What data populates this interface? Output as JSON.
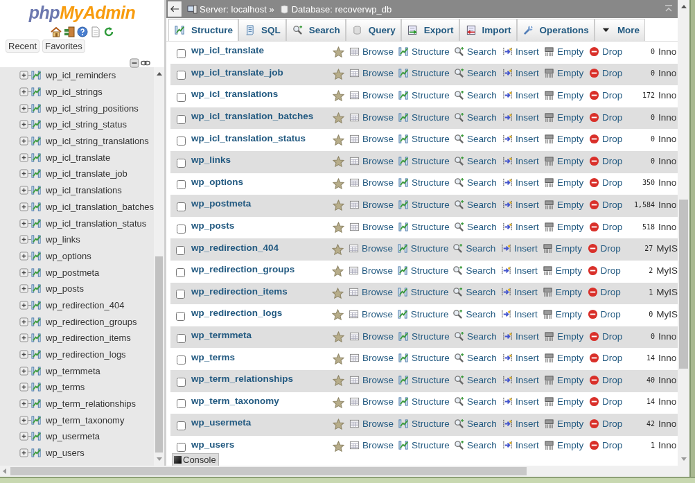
{
  "sidebar": {
    "logo": {
      "part_1": "php",
      "part_2": "MyAdmin"
    },
    "buttons": [
      "Recent",
      "Favorites"
    ],
    "tree": [
      {
        "label": "wp_icl_reminders"
      },
      {
        "label": "wp_icl_strings"
      },
      {
        "label": "wp_icl_string_positions"
      },
      {
        "label": "wp_icl_string_status"
      },
      {
        "label": "wp_icl_string_translations"
      },
      {
        "label": "wp_icl_translate"
      },
      {
        "label": "wp_icl_translate_job"
      },
      {
        "label": "wp_icl_translations"
      },
      {
        "label": "wp_icl_translation_batches"
      },
      {
        "label": "wp_icl_translation_status"
      },
      {
        "label": "wp_links"
      },
      {
        "label": "wp_options"
      },
      {
        "label": "wp_postmeta"
      },
      {
        "label": "wp_posts"
      },
      {
        "label": "wp_redirection_404"
      },
      {
        "label": "wp_redirection_groups"
      },
      {
        "label": "wp_redirection_items"
      },
      {
        "label": "wp_redirection_logs"
      },
      {
        "label": "wp_termmeta"
      },
      {
        "label": "wp_terms"
      },
      {
        "label": "wp_term_relationships"
      },
      {
        "label": "wp_term_taxonomy"
      },
      {
        "label": "wp_usermeta"
      },
      {
        "label": "wp_users"
      }
    ]
  },
  "breadcrumb": {
    "server": "Server: localhost »",
    "database": "Database: recoverwp_db"
  },
  "tabs": [
    {
      "label": "Structure",
      "kind": "structure",
      "selected": true
    },
    {
      "label": "SQL",
      "kind": "sql",
      "selected": false
    },
    {
      "label": "Search",
      "kind": "search",
      "selected": false
    },
    {
      "label": "Query",
      "kind": "query",
      "selected": false
    },
    {
      "label": "Export",
      "kind": "export",
      "selected": false
    },
    {
      "label": "Import",
      "kind": "import",
      "selected": false
    },
    {
      "label": "Operations",
      "kind": "operations",
      "selected": false
    },
    {
      "label": "More",
      "kind": "more",
      "selected": false
    }
  ],
  "table": {
    "rows": [
      {
        "name": "wp_icl_translate",
        "checked": false,
        "actions": [
          "Browse",
          "Structure",
          "Search",
          "Insert",
          "Empty",
          "Drop"
        ],
        "rows": "0",
        "engine": "Inno"
      },
      {
        "name": "wp_icl_translate_job",
        "checked": false,
        "actions": [
          "Browse",
          "Structure",
          "Search",
          "Insert",
          "Empty",
          "Drop"
        ],
        "rows": "0",
        "engine": "Inno"
      },
      {
        "name": "wp_icl_translations",
        "checked": false,
        "actions": [
          "Browse",
          "Structure",
          "Search",
          "Insert",
          "Empty",
          "Drop"
        ],
        "rows": "172",
        "engine": "Inno"
      },
      {
        "name": "wp_icl_translation_batches",
        "checked": false,
        "actions": [
          "Browse",
          "Structure",
          "Search",
          "Insert",
          "Empty",
          "Drop"
        ],
        "rows": "0",
        "engine": "Inno"
      },
      {
        "name": "wp_icl_translation_status",
        "checked": false,
        "actions": [
          "Browse",
          "Structure",
          "Search",
          "Insert",
          "Empty",
          "Drop"
        ],
        "rows": "0",
        "engine": "Inno"
      },
      {
        "name": "wp_links",
        "checked": false,
        "actions": [
          "Browse",
          "Structure",
          "Search",
          "Insert",
          "Empty",
          "Drop"
        ],
        "rows": "0",
        "engine": "Inno"
      },
      {
        "name": "wp_options",
        "checked": false,
        "actions": [
          "Browse",
          "Structure",
          "Search",
          "Insert",
          "Empty",
          "Drop"
        ],
        "rows": "350",
        "engine": "Inno"
      },
      {
        "name": "wp_postmeta",
        "checked": false,
        "actions": [
          "Browse",
          "Structure",
          "Search",
          "Insert",
          "Empty",
          "Drop"
        ],
        "rows": "1,584",
        "engine": "Inno"
      },
      {
        "name": "wp_posts",
        "checked": false,
        "actions": [
          "Browse",
          "Structure",
          "Search",
          "Insert",
          "Empty",
          "Drop"
        ],
        "rows": "518",
        "engine": "Inno"
      },
      {
        "name": "wp_redirection_404",
        "checked": false,
        "actions": [
          "Browse",
          "Structure",
          "Search",
          "Insert",
          "Empty",
          "Drop"
        ],
        "rows": "27",
        "engine": "MyIS"
      },
      {
        "name": "wp_redirection_groups",
        "checked": false,
        "actions": [
          "Browse",
          "Structure",
          "Search",
          "Insert",
          "Empty",
          "Drop"
        ],
        "rows": "2",
        "engine": "MyIS"
      },
      {
        "name": "wp_redirection_items",
        "checked": false,
        "actions": [
          "Browse",
          "Structure",
          "Search",
          "Insert",
          "Empty",
          "Drop"
        ],
        "rows": "1",
        "engine": "MyIS"
      },
      {
        "name": "wp_redirection_logs",
        "checked": false,
        "actions": [
          "Browse",
          "Structure",
          "Search",
          "Insert",
          "Empty",
          "Drop"
        ],
        "rows": "0",
        "engine": "MyIS"
      },
      {
        "name": "wp_termmeta",
        "checked": false,
        "actions": [
          "Browse",
          "Structure",
          "Search",
          "Insert",
          "Empty",
          "Drop"
        ],
        "rows": "0",
        "engine": "Inno"
      },
      {
        "name": "wp_terms",
        "checked": false,
        "actions": [
          "Browse",
          "Structure",
          "Search",
          "Insert",
          "Empty",
          "Drop"
        ],
        "rows": "14",
        "engine": "Inno"
      },
      {
        "name": "wp_term_relationships",
        "checked": false,
        "actions": [
          "Browse",
          "Structure",
          "Search",
          "Insert",
          "Empty",
          "Drop"
        ],
        "rows": "40",
        "engine": "Inno"
      },
      {
        "name": "wp_term_taxonomy",
        "checked": false,
        "actions": [
          "Browse",
          "Structure",
          "Search",
          "Insert",
          "Empty",
          "Drop"
        ],
        "rows": "14",
        "engine": "Inno"
      },
      {
        "name": "wp_usermeta",
        "checked": false,
        "actions": [
          "Browse",
          "Structure",
          "Search",
          "Insert",
          "Empty",
          "Drop"
        ],
        "rows": "42",
        "engine": "Inno"
      },
      {
        "name": "wp_users",
        "checked": false,
        "actions": [
          "Browse",
          "Structure",
          "Search",
          "Insert",
          "Empty",
          "Drop"
        ],
        "rows": "1",
        "engine": "Inno"
      }
    ]
  },
  "console": {
    "label": "Console"
  }
}
